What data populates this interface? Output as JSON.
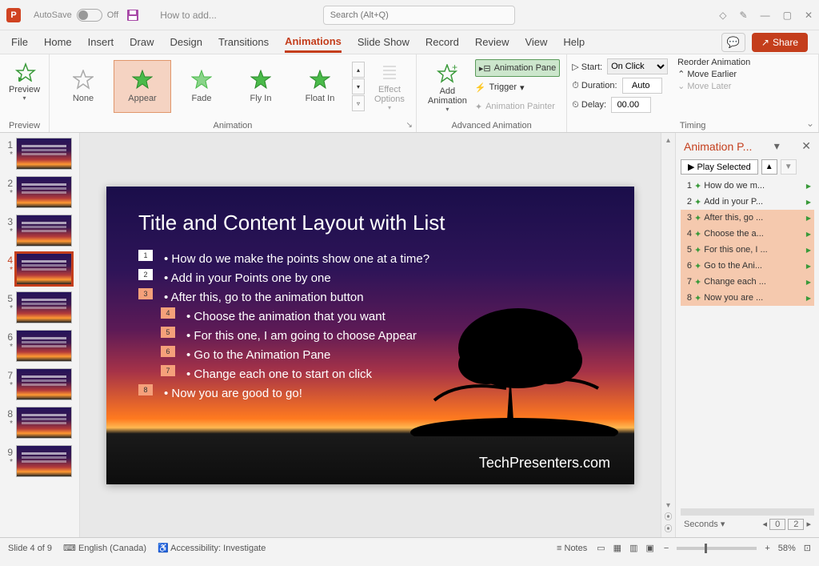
{
  "app": {
    "name": "P",
    "autosave_label": "AutoSave",
    "autosave_state": "Off",
    "document_title": "How to add...",
    "search_placeholder": "Search (Alt+Q)"
  },
  "tabs": {
    "file": "File",
    "home": "Home",
    "insert": "Insert",
    "draw": "Draw",
    "design": "Design",
    "transitions": "Transitions",
    "animations": "Animations",
    "slideshow": "Slide Show",
    "record": "Record",
    "review": "Review",
    "view": "View",
    "help": "Help",
    "share": "Share"
  },
  "ribbon": {
    "preview": {
      "label": "Preview",
      "btn": "Preview"
    },
    "animation": {
      "label": "Animation",
      "none": "None",
      "appear": "Appear",
      "fade": "Fade",
      "flyin": "Fly In",
      "floatin": "Float In",
      "effect_options": "Effect\nOptions"
    },
    "advanced": {
      "label": "Advanced Animation",
      "add": "Add\nAnimation",
      "pane": "Animation Pane",
      "trigger": "Trigger",
      "painter": "Animation Painter"
    },
    "timing": {
      "label": "Timing",
      "start": "Start:",
      "start_val": "On Click",
      "duration": "Duration:",
      "duration_val": "Auto",
      "delay": "Delay:",
      "delay_val": "00.00",
      "reorder": "Reorder Animation",
      "earlier": "Move Earlier",
      "later": "Move Later"
    }
  },
  "slide": {
    "title": "Title and Content Layout with List",
    "b1": "How do we make the points show one at a time?",
    "b2": "Add in your Points one by one",
    "b3": "After this, go to the animation button",
    "b4": "Choose the animation that you want",
    "b5": "For this one, I am going to choose Appear",
    "b6": "Go to the Animation Pane",
    "b7": "Change each one to start on click",
    "b8": "Now you are good to go!",
    "footer": "TechPresenters.com"
  },
  "animpane": {
    "title": "Animation P...",
    "play": "Play Selected",
    "items": [
      {
        "n": "1",
        "t": "How do we m...",
        "sel": false
      },
      {
        "n": "2",
        "t": "Add in your P...",
        "sel": false
      },
      {
        "n": "3",
        "t": "After this, go ...",
        "sel": true
      },
      {
        "n": "4",
        "t": "Choose the a...",
        "sel": true
      },
      {
        "n": "5",
        "t": "For this one, I ...",
        "sel": true
      },
      {
        "n": "6",
        "t": "Go to the Ani...",
        "sel": true
      },
      {
        "n": "7",
        "t": "Change each ...",
        "sel": true
      },
      {
        "n": "8",
        "t": "Now you are ...",
        "sel": true
      }
    ],
    "seconds": "Seconds",
    "cur": "0",
    "total": "2"
  },
  "status": {
    "slide": "Slide 4 of 9",
    "lang": "English (Canada)",
    "acc": "Accessibility: Investigate",
    "notes": "Notes",
    "zoom": "58%"
  }
}
